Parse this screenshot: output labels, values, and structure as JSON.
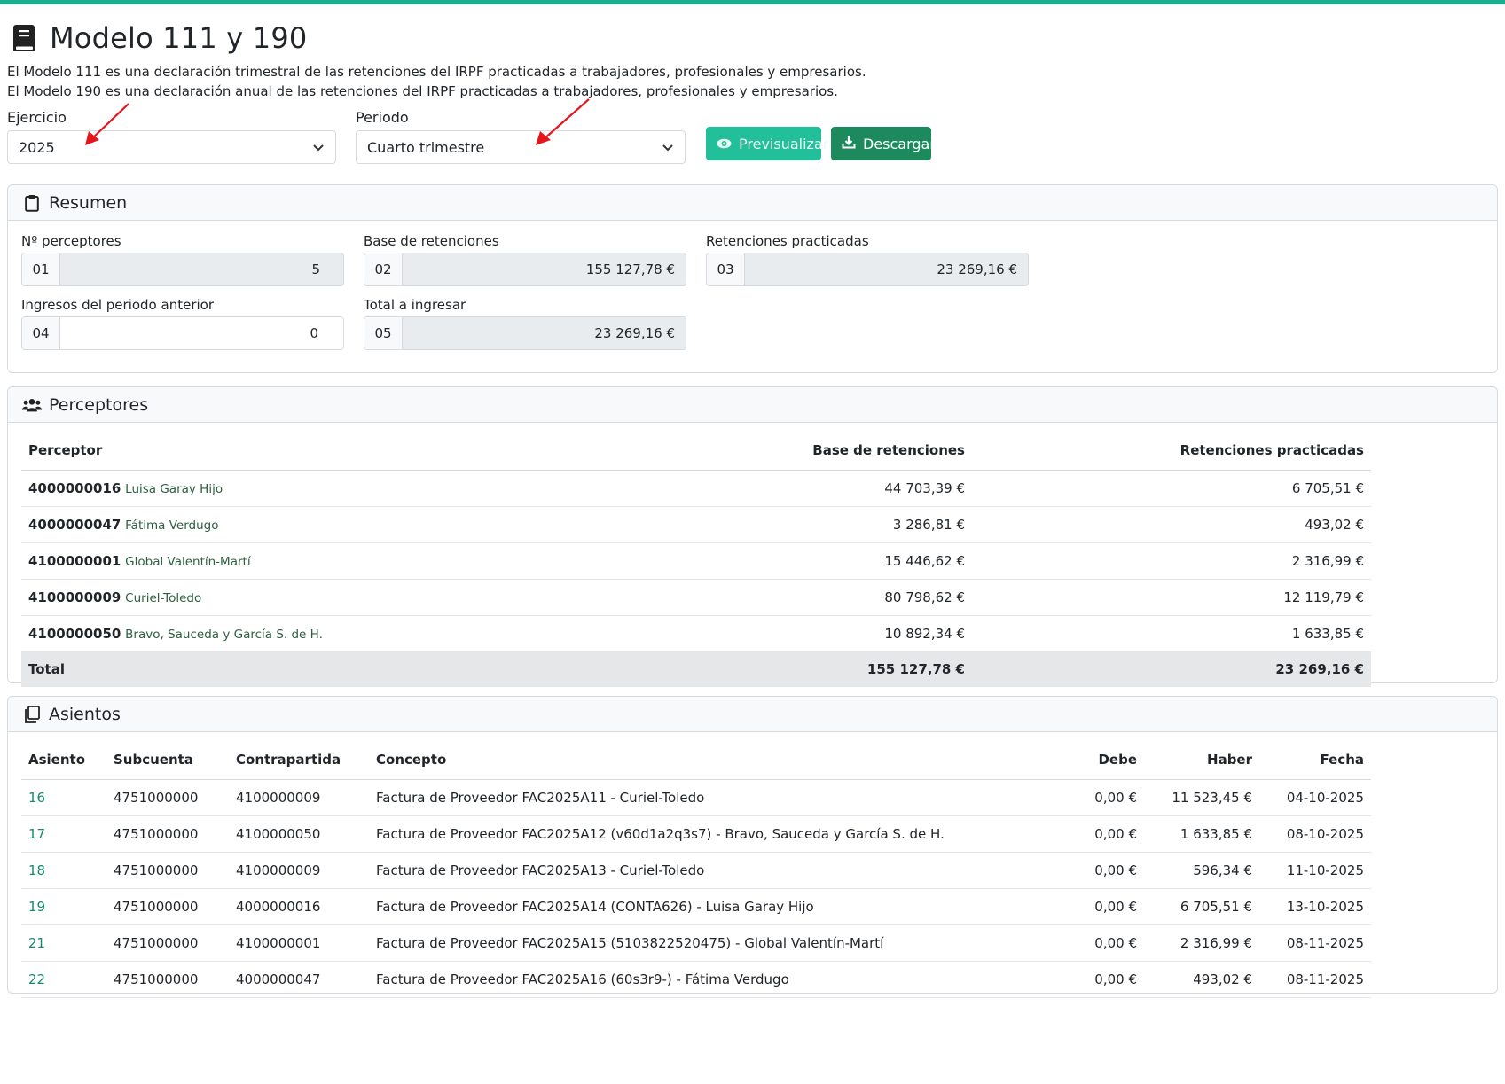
{
  "header": {
    "title": "Modelo 111 y 190",
    "description_1": "El Modelo 111 es una declaración trimestral de las retenciones del IRPF practicadas a trabajadores, profesionales y empresarios.",
    "description_2": "El Modelo 190 es una declaración anual de las retenciones del IRPF practicadas a trabajadores, profesionales y empresarios."
  },
  "filters": {
    "ejercicio_label": "Ejercicio",
    "ejercicio_value": "2025",
    "periodo_label": "Periodo",
    "periodo_value": "Cuarto trimestre",
    "preview_label": "Previsualizar",
    "download_label": "Descargar"
  },
  "resumen": {
    "title": "Resumen",
    "fields": [
      {
        "label": "Nº perceptores",
        "code": "01",
        "value": "5"
      },
      {
        "label": "Base de retenciones",
        "code": "02",
        "value": "155 127,78 €"
      },
      {
        "label": "Retenciones practicadas",
        "code": "03",
        "value": "23 269,16 €"
      },
      {
        "label": "Ingresos del periodo anterior",
        "code": "04",
        "value": "0"
      },
      {
        "label": "Total a ingresar",
        "code": "05",
        "value": "23 269,16 €"
      }
    ]
  },
  "perceptores": {
    "title": "Perceptores",
    "columns": [
      "Perceptor",
      "Base de retenciones",
      "Retenciones practicadas"
    ],
    "rows": [
      {
        "code": "4000000016",
        "name": "Luisa Garay Hijo",
        "base": "44 703,39 €",
        "ret": "6 705,51 €"
      },
      {
        "code": "4000000047",
        "name": "Fátima Verdugo",
        "base": "3 286,81 €",
        "ret": "493,02 €"
      },
      {
        "code": "4100000001",
        "name": "Global Valentín-Martí",
        "base": "15 446,62 €",
        "ret": "2 316,99 €"
      },
      {
        "code": "4100000009",
        "name": "Curiel-Toledo",
        "base": "80 798,62 €",
        "ret": "12 119,79 €"
      },
      {
        "code": "4100000050",
        "name": "Bravo, Sauceda y García S. de H.",
        "base": "10 892,34 €",
        "ret": "1 633,85 €"
      }
    ],
    "total": {
      "label": "Total",
      "base": "155 127,78 €",
      "ret": "23 269,16 €"
    }
  },
  "asientos": {
    "title": "Asientos",
    "columns": [
      "Asiento",
      "Subcuenta",
      "Contrapartida",
      "Concepto",
      "Debe",
      "Haber",
      "Fecha"
    ],
    "rows": [
      {
        "asiento": "16",
        "subcuenta": "4751000000",
        "contra": "4100000009",
        "concepto": "Factura de Proveedor FAC2025A11 - Curiel-Toledo",
        "debe": "0,00 €",
        "haber": "11 523,45 €",
        "fecha": "04-10-2025"
      },
      {
        "asiento": "17",
        "subcuenta": "4751000000",
        "contra": "4100000050",
        "concepto": "Factura de Proveedor FAC2025A12 (v60d1a2q3s7) - Bravo, Sauceda y García S. de H.",
        "debe": "0,00 €",
        "haber": "1 633,85 €",
        "fecha": "08-10-2025"
      },
      {
        "asiento": "18",
        "subcuenta": "4751000000",
        "contra": "4100000009",
        "concepto": "Factura de Proveedor FAC2025A13 - Curiel-Toledo",
        "debe": "0,00 €",
        "haber": "596,34 €",
        "fecha": "11-10-2025"
      },
      {
        "asiento": "19",
        "subcuenta": "4751000000",
        "contra": "4000000016",
        "concepto": "Factura de Proveedor FAC2025A14 (CONTA626) - Luisa Garay Hijo",
        "debe": "0,00 €",
        "haber": "6 705,51 €",
        "fecha": "13-10-2025"
      },
      {
        "asiento": "21",
        "subcuenta": "4751000000",
        "contra": "4100000001",
        "concepto": "Factura de Proveedor FAC2025A15 (5103822520475) - Global Valentín-Martí",
        "debe": "0,00 €",
        "haber": "2 316,99 €",
        "fecha": "08-11-2025"
      },
      {
        "asiento": "22",
        "subcuenta": "4751000000",
        "contra": "4000000047",
        "concepto": "Factura de Proveedor FAC2025A16 (60s3r9-) - Fátima Verdugo",
        "debe": "0,00 €",
        "haber": "493,02 €",
        "fecha": "08-11-2025"
      }
    ]
  },
  "icons": {
    "title": "book-icon",
    "preview": "eye-icon",
    "download": "download-icon",
    "resumen": "clipboard-icon",
    "perceptores": "users-icon",
    "asientos": "copy-icon",
    "select": "chevron-down-icon",
    "annotation": "red-arrow-icon"
  },
  "colors": {
    "accent": "#1aae8e",
    "preview_button": "#21c09a",
    "download_button": "#1d8a5e",
    "link": "#168a6c",
    "annotation": "#e8141b"
  }
}
